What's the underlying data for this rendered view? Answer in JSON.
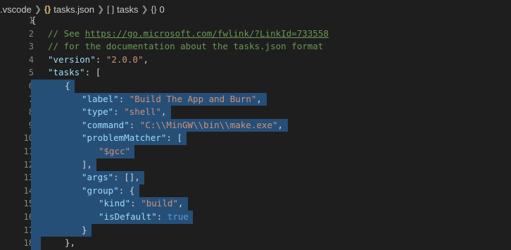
{
  "breadcrumb": {
    "items": [
      {
        "label": ".vscode",
        "icon": ""
      },
      {
        "label": "tasks.json",
        "icon": "{}"
      },
      {
        "label": "tasks",
        "icon": "[ ]"
      },
      {
        "label": "0",
        "icon": "{}"
      }
    ]
  },
  "lines": [
    {
      "n": "1",
      "tokens": [
        [
          "punc",
          "{"
        ]
      ]
    },
    {
      "n": "2",
      "tokens": [
        [
          "cmt",
          "// See "
        ],
        [
          "link",
          "https://go.microsoft.com/fwlink/?LinkId=733558"
        ]
      ]
    },
    {
      "n": "3",
      "tokens": [
        [
          "cmt",
          "// for the documentation about the tasks.json format"
        ]
      ]
    },
    {
      "n": "4",
      "tokens": [
        [
          "key",
          "\"version\""
        ],
        [
          "punc",
          ": "
        ],
        [
          "str",
          "\"2.0.0\""
        ],
        [
          "punc",
          ","
        ]
      ]
    },
    {
      "n": "5",
      "tokens": [
        [
          "key",
          "\"tasks\""
        ],
        [
          "punc",
          ": ["
        ]
      ]
    },
    {
      "n": "6",
      "tokens": [
        [
          "punc",
          "{"
        ]
      ]
    },
    {
      "n": "7",
      "tokens": [
        [
          "key",
          "\"label\""
        ],
        [
          "punc",
          ": "
        ],
        [
          "str",
          "\"Build The App and Burn\""
        ],
        [
          "punc",
          ","
        ]
      ]
    },
    {
      "n": "8",
      "tokens": [
        [
          "key",
          "\"type\""
        ],
        [
          "punc",
          ": "
        ],
        [
          "str",
          "\"shell\""
        ],
        [
          "punc",
          ","
        ]
      ]
    },
    {
      "n": "9",
      "tokens": [
        [
          "key",
          "\"command\""
        ],
        [
          "punc",
          ": "
        ],
        [
          "str",
          "\"C:\\\\MinGW\\\\bin\\\\make.exe\""
        ],
        [
          "punc",
          ","
        ]
      ]
    },
    {
      "n": "10",
      "tokens": [
        [
          "key",
          "\"problemMatcher\""
        ],
        [
          "punc",
          ": ["
        ]
      ]
    },
    {
      "n": "11",
      "tokens": [
        [
          "str",
          "\"$gcc\""
        ]
      ]
    },
    {
      "n": "12",
      "tokens": [
        [
          "punc",
          "],"
        ]
      ]
    },
    {
      "n": "13",
      "tokens": [
        [
          "key",
          "\"args\""
        ],
        [
          "punc",
          ": [],"
        ]
      ]
    },
    {
      "n": "14",
      "tokens": [
        [
          "key",
          "\"group\""
        ],
        [
          "punc",
          ": {"
        ]
      ]
    },
    {
      "n": "15",
      "tokens": [
        [
          "key",
          "\"kind\""
        ],
        [
          "punc",
          ": "
        ],
        [
          "str",
          "\"build\""
        ],
        [
          "punc",
          ","
        ]
      ]
    },
    {
      "n": "16",
      "tokens": [
        [
          "key",
          "\"isDefault\""
        ],
        [
          "punc",
          ": "
        ],
        [
          "kw",
          "true"
        ]
      ]
    },
    {
      "n": "17",
      "tokens": [
        [
          "punc",
          "}"
        ]
      ]
    },
    {
      "n": "18",
      "tokens": [
        [
          "punc",
          "},"
        ]
      ]
    }
  ]
}
